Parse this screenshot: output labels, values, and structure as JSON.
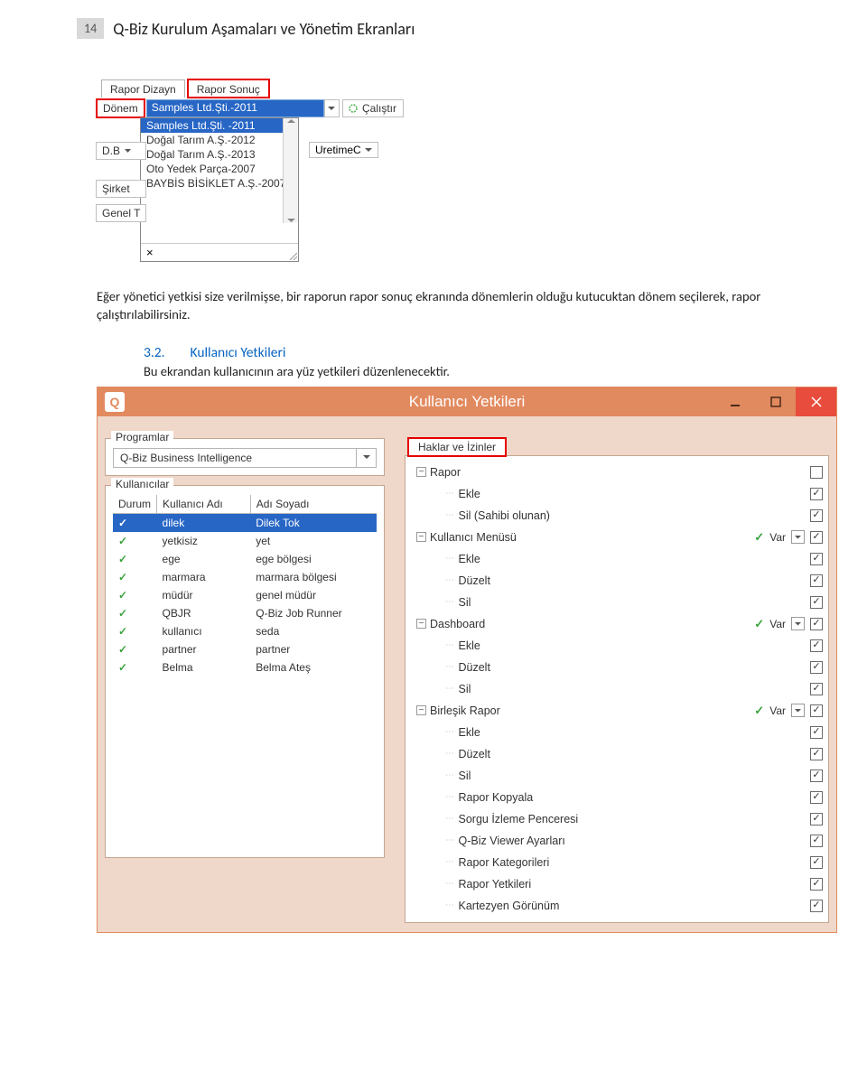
{
  "page": {
    "number": "14",
    "title": "Q-Biz Kurulum Aşamaları ve Yönetim Ekranları"
  },
  "shot1": {
    "tabs": {
      "design": "Rapor Dizayn",
      "result": "Rapor Sonuç"
    },
    "donem_label": "Dönem",
    "donem_value": "Samples Ltd.Şti.-2011",
    "calistir": "Çalıştır",
    "db_label": "D.B",
    "uretime_label": "UretimeC",
    "sirket_label": "Şirket",
    "genel_label": "Genel T",
    "dd": {
      "selected": "Samples Ltd.Şti. -2011",
      "items": [
        "Doğal Tarım A.Ş.-2012",
        "Doğal Tarım A.Ş.-2013",
        "Oto Yedek Parça-2007",
        "BAYBİS BİSİKLET A.Ş.-2007"
      ],
      "close": "×"
    }
  },
  "para1": "Eğer yönetici yetkisi size verilmişse, bir raporun rapor sonuç ekranında dönemlerin olduğu kutucuktan dönem seçilerek, rapor çalıştırılabilirsiniz.",
  "section": {
    "num": "3.2.",
    "title": "Kullanıcı Yetkileri"
  },
  "para2": "Bu ekrandan kullanıcının ara yüz yetkileri düzenlenecektir.",
  "shot2": {
    "title": "Kullanıcı Yetkileri",
    "groups": {
      "programs": "Programlar",
      "users": "Kullanıcılar",
      "perms": "Haklar ve İzinler"
    },
    "program": "Q-Biz Business Intelligence",
    "cols": {
      "durum": "Durum",
      "user": "Kullanıcı Adı",
      "name": "Adı Soyadı"
    },
    "users": [
      {
        "u": "dilek",
        "n": "Dilek Tok",
        "sel": true
      },
      {
        "u": "yetkisiz",
        "n": "yet"
      },
      {
        "u": "ege",
        "n": "ege bölgesi"
      },
      {
        "u": "marmara",
        "n": "marmara bölgesi"
      },
      {
        "u": "müdür",
        "n": "genel müdür"
      },
      {
        "u": "QBJR",
        "n": "Q-Biz Job Runner"
      },
      {
        "u": "kullanıcı",
        "n": "seda"
      },
      {
        "u": "partner",
        "n": "partner"
      },
      {
        "u": "Belma",
        "n": "Belma Ateş"
      }
    ],
    "var_label": "Var",
    "perms": [
      {
        "lvl": 0,
        "toggle": "-",
        "label": "Rapor",
        "type": "group"
      },
      {
        "lvl": 1,
        "label": "Ekle",
        "type": "chk"
      },
      {
        "lvl": 1,
        "label": "Sil (Sahibi olunan)",
        "type": "chk"
      },
      {
        "lvl": 0,
        "toggle": "-",
        "label": "Kullanıcı Menüsü",
        "type": "groupvar"
      },
      {
        "lvl": 1,
        "label": "Ekle",
        "type": "chk"
      },
      {
        "lvl": 1,
        "label": "Düzelt",
        "type": "chk"
      },
      {
        "lvl": 1,
        "label": "Sil",
        "type": "chk"
      },
      {
        "lvl": 0,
        "toggle": "-",
        "label": "Dashboard",
        "type": "groupvar"
      },
      {
        "lvl": 1,
        "label": "Ekle",
        "type": "chk"
      },
      {
        "lvl": 1,
        "label": "Düzelt",
        "type": "chk"
      },
      {
        "lvl": 1,
        "label": "Sil",
        "type": "chk"
      },
      {
        "lvl": 0,
        "toggle": "-",
        "label": "Birleşik Rapor",
        "type": "groupvar"
      },
      {
        "lvl": 1,
        "label": "Ekle",
        "type": "chk"
      },
      {
        "lvl": 1,
        "label": "Düzelt",
        "type": "chk"
      },
      {
        "lvl": 1,
        "label": "Sil",
        "type": "chk"
      },
      {
        "lvl": 1,
        "label": "Rapor Kopyala",
        "type": "chk"
      },
      {
        "lvl": 1,
        "label": "Sorgu İzleme Penceresi",
        "type": "chk"
      },
      {
        "lvl": 1,
        "label": "Q-Biz Viewer Ayarları",
        "type": "chk"
      },
      {
        "lvl": 1,
        "label": "Rapor Kategorileri",
        "type": "chk"
      },
      {
        "lvl": 1,
        "label": "Rapor Yetkileri",
        "type": "chk"
      },
      {
        "lvl": 1,
        "label": "Kartezyen Görünüm",
        "type": "chk"
      }
    ]
  }
}
